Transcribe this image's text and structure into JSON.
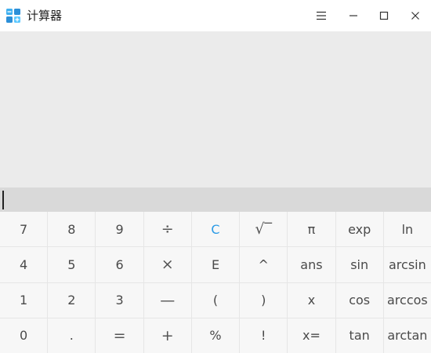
{
  "window": {
    "title": "计算器",
    "icons": {
      "app": "calculator-app-icon",
      "menu": "hamburger-menu-icon",
      "minimize": "minimize-icon",
      "maximize": "maximize-icon",
      "close": "close-icon"
    }
  },
  "display": {
    "history": "",
    "input": ""
  },
  "colors": {
    "accent": "#2b9be6"
  },
  "keys": [
    [
      "7",
      "8",
      "9",
      "÷",
      "C",
      "√‾",
      "π",
      "exp",
      "ln"
    ],
    [
      "4",
      "5",
      "6",
      "×",
      "E",
      "^",
      "ans",
      "sin",
      "arcsin"
    ],
    [
      "1",
      "2",
      "3",
      "—",
      "(",
      ")",
      "x",
      "cos",
      "arccos"
    ],
    [
      "0",
      ".",
      "=",
      "+",
      "%",
      "!",
      "x=",
      "tan",
      "arctan"
    ]
  ]
}
